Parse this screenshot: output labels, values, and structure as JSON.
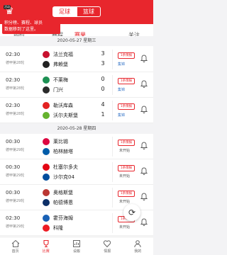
{
  "header": {
    "logo_badge": "活动",
    "sport_tabs": [
      "足球",
      "篮球"
    ]
  },
  "subtabs": [
    "即时",
    "赛程",
    "赛果",
    "关注"
  ],
  "tooltip": {
    "line1": "积分榜、赛程、球员",
    "line2": "数据移到了这里。"
  },
  "dates": [
    "2020-05-27 星期三",
    "2020-05-28 星期四"
  ],
  "matches": [
    {
      "time": "02:30",
      "league": "德甲第28轮",
      "home": "法兰克福",
      "away": "弗赖堡",
      "home_score": "3",
      "away_score": "3",
      "badge": "1条情报",
      "status": "集锦",
      "home_color": "#c8102e",
      "away_color": "#222222"
    },
    {
      "time": "02:30",
      "league": "德甲第28轮",
      "home": "不莱梅",
      "away": "门兴",
      "home_score": "0",
      "away_score": "0",
      "badge": "1条情报",
      "status": "集锦",
      "home_color": "#1d9053",
      "away_color": "#2a2a2a"
    },
    {
      "time": "02:30",
      "league": "德甲第28轮",
      "home": "勒沃库森",
      "away": "沃尔夫斯堡",
      "home_score": "4",
      "away_score": "1",
      "badge": "1条情报",
      "status": "集锦",
      "home_color": "#e32221",
      "away_color": "#65b32e"
    },
    {
      "time": "00:30",
      "league": "德甲第29轮",
      "home": "莱比锡",
      "away": "柏林赫塔",
      "home_score": "",
      "away_score": "",
      "badge": "1条情报",
      "status": "未开始",
      "home_color": "#dd0741",
      "away_color": "#005ca9"
    },
    {
      "time": "00:30",
      "league": "德甲第29轮",
      "home": "杜塞尔多夫",
      "away": "沙尔克04",
      "home_score": "",
      "away_score": "",
      "badge": "1条情报",
      "status": "未开始",
      "home_color": "#e30613",
      "away_color": "#004d9d"
    },
    {
      "time": "00:30",
      "league": "德甲第29轮",
      "home": "奥格斯堡",
      "away": "帕德博恩",
      "home_score": "",
      "away_score": "",
      "badge": "1条情报",
      "status": "未开始",
      "home_color": "#ba3733",
      "away_color": "#0c2f67"
    },
    {
      "time": "02:30",
      "league": "德甲第29轮",
      "home": "霍芬海姆",
      "away": "科隆",
      "home_score": "",
      "away_score": "",
      "badge": "1条情报",
      "status": "未开始",
      "home_color": "#1961b5",
      "away_color": "#ed1c24"
    },
    {
      "time": "02:30",
      "league": "德甲第29轮",
      "home": "柏林联合",
      "away": "美因茨",
      "home_score": "",
      "away_score": "",
      "badge": "1条情报",
      "status": "未开始",
      "home_color": "#eb1923",
      "away_color": "#c3141e"
    }
  ],
  "bottom_nav": [
    {
      "label": "首页",
      "icon": "home-icon"
    },
    {
      "label": "比赛",
      "icon": "trophy-icon"
    },
    {
      "label": "设搬",
      "icon": "chart-icon"
    },
    {
      "label": "情报",
      "icon": "heart-icon"
    },
    {
      "label": "我的",
      "icon": "user-icon"
    }
  ],
  "colors": {
    "accent": "#e8262d",
    "link": "#3a78c9"
  }
}
